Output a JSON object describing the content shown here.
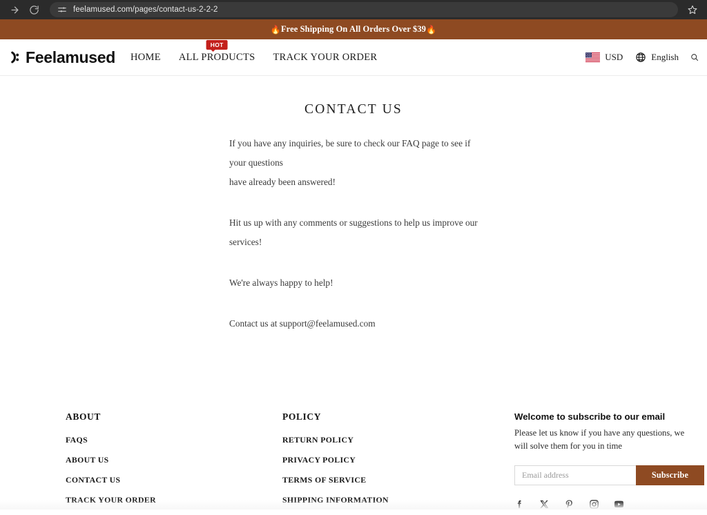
{
  "browser": {
    "url": "feelamused.com/pages/contact-us-2-2-2",
    "forward_icon": "forward-arrow-icon",
    "reload_icon": "reload-icon",
    "site_settings_icon": "tune-icon",
    "bookmark_icon": "star-icon"
  },
  "announcement": {
    "text": "Free Shipping On All Orders Over $39",
    "flame": "🔥",
    "bg_color": "#8e4a22",
    "text_color": "#ffffff"
  },
  "header": {
    "logo_text": "Feelamused",
    "logo_icon": "smiley-face-icon",
    "nav": [
      {
        "label": "HOME"
      },
      {
        "label": "ALL PRODUCTS",
        "badge": "HOT",
        "badge_color": "#c3201c"
      },
      {
        "label": "TRACK YOUR ORDER"
      }
    ],
    "currency": {
      "label": "USD",
      "flag": "us-flag-icon"
    },
    "language": {
      "label": "English",
      "icon": "globe-icon"
    },
    "search_icon": "search-icon"
  },
  "main": {
    "title": "CONTACT US",
    "paragraphs": [
      "If you have any inquiries, be sure to check our FAQ page to see if your questions",
      "have already been answered!",
      "Hit us up with any comments or suggestions to help us improve our services!",
      "We're always happy to help!",
      "Contact us at support@feelamused.com"
    ]
  },
  "footer": {
    "about": {
      "heading": "ABOUT",
      "links": [
        "FAQS",
        "ABOUT US",
        "CONTACT US",
        "TRACK YOUR ORDER"
      ]
    },
    "policy": {
      "heading": "POLICY",
      "links": [
        "RETURN POLICY",
        "PRIVACY POLICY",
        "TERMS OF SERVICE",
        "SHIPPING INFORMATION"
      ]
    },
    "newsletter": {
      "title": "Welcome to subscribe to our email",
      "subtitle": "Please let us know if you have any questions, we will solve them for you in time",
      "email_placeholder": "Email address",
      "email_value": "",
      "button_label": "Subscribe",
      "button_color": "#8e4a22"
    },
    "socials": [
      {
        "name": "facebook-icon"
      },
      {
        "name": "x-twitter-icon"
      },
      {
        "name": "pinterest-icon"
      },
      {
        "name": "instagram-icon"
      },
      {
        "name": "youtube-icon"
      }
    ]
  }
}
